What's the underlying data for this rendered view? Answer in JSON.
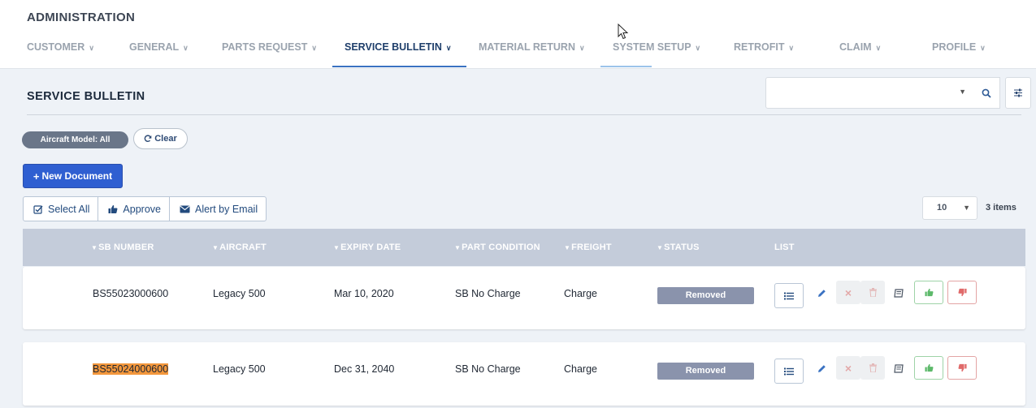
{
  "app": {
    "title": "ADMINISTRATION"
  },
  "nav": {
    "tabs": [
      {
        "label": "CUSTOMER",
        "active": false
      },
      {
        "label": "GENERAL",
        "active": false
      },
      {
        "label": "PARTS REQUEST",
        "active": false
      },
      {
        "label": "SERVICE BULLETIN",
        "active": true
      },
      {
        "label": "MATERIAL RETURN",
        "active": false
      },
      {
        "label": "SYSTEM SETUP",
        "active": false
      },
      {
        "label": "RETROFIT",
        "active": false
      },
      {
        "label": "CLAIM",
        "active": false
      },
      {
        "label": "PROFILE",
        "active": false
      }
    ]
  },
  "page": {
    "title": "SERVICE BULLETIN"
  },
  "search": {
    "value": ""
  },
  "filters": {
    "chip_label": "Aircraft Model: All",
    "clear_label": "Clear"
  },
  "actions": {
    "new_document": "New Document",
    "select_all": "Select All",
    "approve": "Approve",
    "alert_by_email": "Alert by Email"
  },
  "pagination": {
    "page_size": "10",
    "count_label": "3 items"
  },
  "table": {
    "headers": {
      "sb_number": "SB NUMBER",
      "aircraft": "AIRCRAFT",
      "expiry_date": "EXPIRY DATE",
      "part_condition": "PART CONDITION",
      "freight": "FREIGHT",
      "status": "STATUS",
      "list": "LIST"
    },
    "rows": [
      {
        "sb_number": "BS55023000600",
        "aircraft": "Legacy 500",
        "expiry_date": "Mar 10, 2020",
        "part_condition": "SB No Charge",
        "freight": "Charge",
        "status": "Removed",
        "highlighted": false
      },
      {
        "sb_number": "BS55024000600",
        "aircraft": "Legacy 500",
        "expiry_date": "Dec 31, 2040",
        "part_condition": "SB No Charge",
        "freight": "Charge",
        "status": "Removed",
        "highlighted": true
      }
    ]
  },
  "colors": {
    "primary": "#2f5fd1",
    "accent": "#3a72c2",
    "header_bg": "#c4ccda",
    "status_removed": "#8a93ac",
    "highlight": "#f3973c",
    "approve_green": "#5cb96a",
    "reject_red": "#e06a6a"
  },
  "icons": {
    "search": "search-icon",
    "filter": "sliders-icon",
    "refresh": "refresh-icon",
    "plus": "plus-icon",
    "check": "check-square-icon",
    "thumbs_up": "thumbs-up-icon",
    "thumbs_down": "thumbs-down-icon",
    "envelope": "envelope-icon",
    "list": "list-icon",
    "pencil": "pencil-icon",
    "times": "times-icon",
    "trash": "trash-icon",
    "book": "book-icon"
  }
}
